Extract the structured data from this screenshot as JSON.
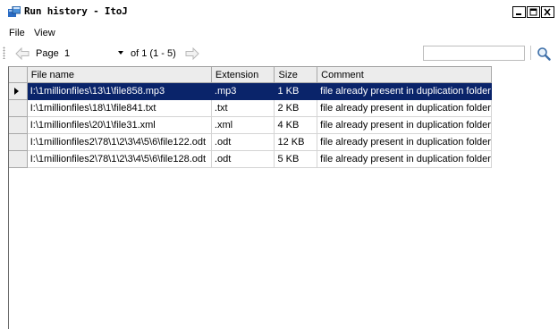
{
  "window": {
    "title": "Run history - ItoJ"
  },
  "menu": {
    "items": [
      "File",
      "View"
    ]
  },
  "toolbar": {
    "page_label": "Page",
    "page_value": "1",
    "of_label": "of 1  (1 - 5)",
    "search_value": ""
  },
  "grid": {
    "columns": [
      "File name",
      "Extension",
      "Size",
      "Comment"
    ],
    "selected_row": 0,
    "rows": [
      {
        "file": "I:\\1millionfiles\\13\\1\\file858.mp3",
        "ext": ".mp3",
        "size": "1 KB",
        "comment": "file already present in duplication folder"
      },
      {
        "file": "I:\\1millionfiles\\18\\1\\file841.txt",
        "ext": ".txt",
        "size": "2 KB",
        "comment": "file already present in duplication folder"
      },
      {
        "file": "I:\\1millionfiles\\20\\1\\file31.xml",
        "ext": ".xml",
        "size": "4 KB",
        "comment": "file already present in duplication folder"
      },
      {
        "file": "I:\\1millionfiles2\\78\\1\\2\\3\\4\\5\\6\\file122.odt",
        "ext": ".odt",
        "size": "12 KB",
        "comment": "file already present in duplication folder"
      },
      {
        "file": "I:\\1millionfiles2\\78\\1\\2\\3\\4\\5\\6\\file128.odt",
        "ext": ".odt",
        "size": "5 KB",
        "comment": "file already present in duplication folder"
      }
    ]
  },
  "colors": {
    "selection": "#0a246a",
    "header_bg": "#ececec"
  }
}
